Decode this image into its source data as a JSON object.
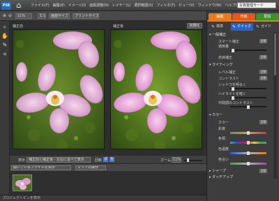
{
  "app": {
    "logo": "PSE",
    "title": "写真整理モード"
  },
  "menu": [
    "ファイル(F)",
    "編集(E)",
    "イメージ(I)",
    "画質調整(N)",
    "レイヤー(L)",
    "選択範囲(S)",
    "フィルタ(T)",
    "ビュー(V)",
    "ウィンドウ(W)",
    "ヘルプ(H)"
  ],
  "options": {
    "zoom": "11%",
    "one_to_one": "1:1",
    "fit_screen": "画面サイズ",
    "print_size": "プリントサイズ"
  },
  "mode_tabs": [
    "編集",
    "作成",
    "配信"
  ],
  "sub_tabs": [
    "標準",
    "クイック",
    "ガイド"
  ],
  "panels": {
    "before": "補正前",
    "after": "補正後",
    "reset": "初期化"
  },
  "view": {
    "label": "表示",
    "option": "補正前と補正後 - 左右に並べて表示",
    "rotate_label": "回転",
    "zoom_label": "ズーム",
    "zoom_value": "11%"
  },
  "bin": {
    "show_label": "開いているファイルを表示",
    "action_label": "エリアの操作"
  },
  "status": "プロジェクトビンを表示",
  "sections": {
    "general": {
      "title": "一般補正",
      "smart_fix": "スマート補正",
      "amount": "適用量",
      "red_eye": "赤目補正",
      "auto": "自動"
    },
    "lighting": {
      "title": "ライティング",
      "levels": "レベル補正",
      "contrast": "コントラスト",
      "shadow": "シャドウを明るく",
      "highlight": "ハイライトを暗く",
      "midtone": "中間調のコントラスト",
      "auto": "自動"
    },
    "color": {
      "title": "カラー",
      "color_label": "カラー",
      "saturation": "彩度",
      "hue": "色相",
      "temperature": "色温度",
      "tint": "色合い",
      "auto": "自動"
    },
    "sharpen": {
      "title": "シャープ",
      "auto": "自動"
    },
    "touchup": {
      "title": "タッチアップ"
    }
  },
  "colors": {
    "edit_tab": "#e87a1f",
    "create_tab": "#e25a16",
    "share_tab": "#3f8f2f"
  }
}
